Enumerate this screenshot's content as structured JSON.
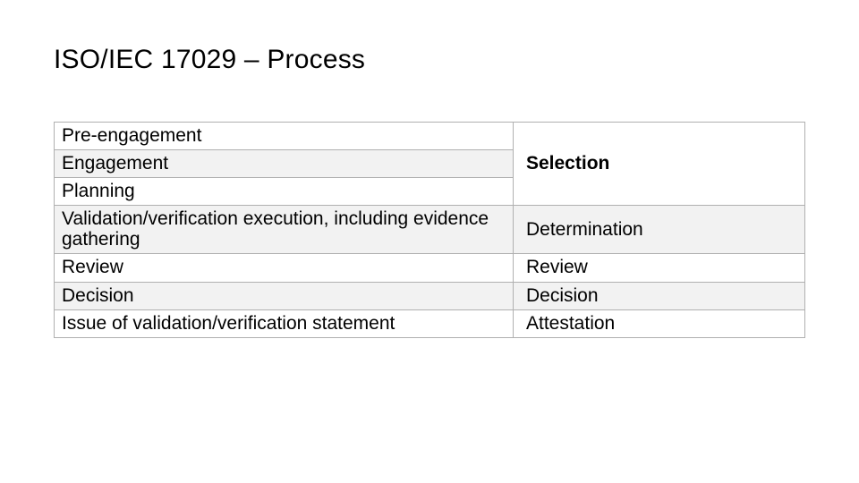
{
  "title": "ISO/IEC 17029 – Process",
  "rows": {
    "r1_left": "Pre-engagement",
    "r2_left": "Engagement",
    "r3_left": "Planning",
    "r4_left": "Validation/verification execution, including evidence gathering",
    "r5_left": "Review",
    "r6_left": "Decision",
    "r7_left": "Issue of validation/verification statement",
    "right_selection": "Selection",
    "right_determination": "Determination",
    "right_review": "Review",
    "right_decision": "Decision",
    "right_attestation": "Attestation"
  }
}
